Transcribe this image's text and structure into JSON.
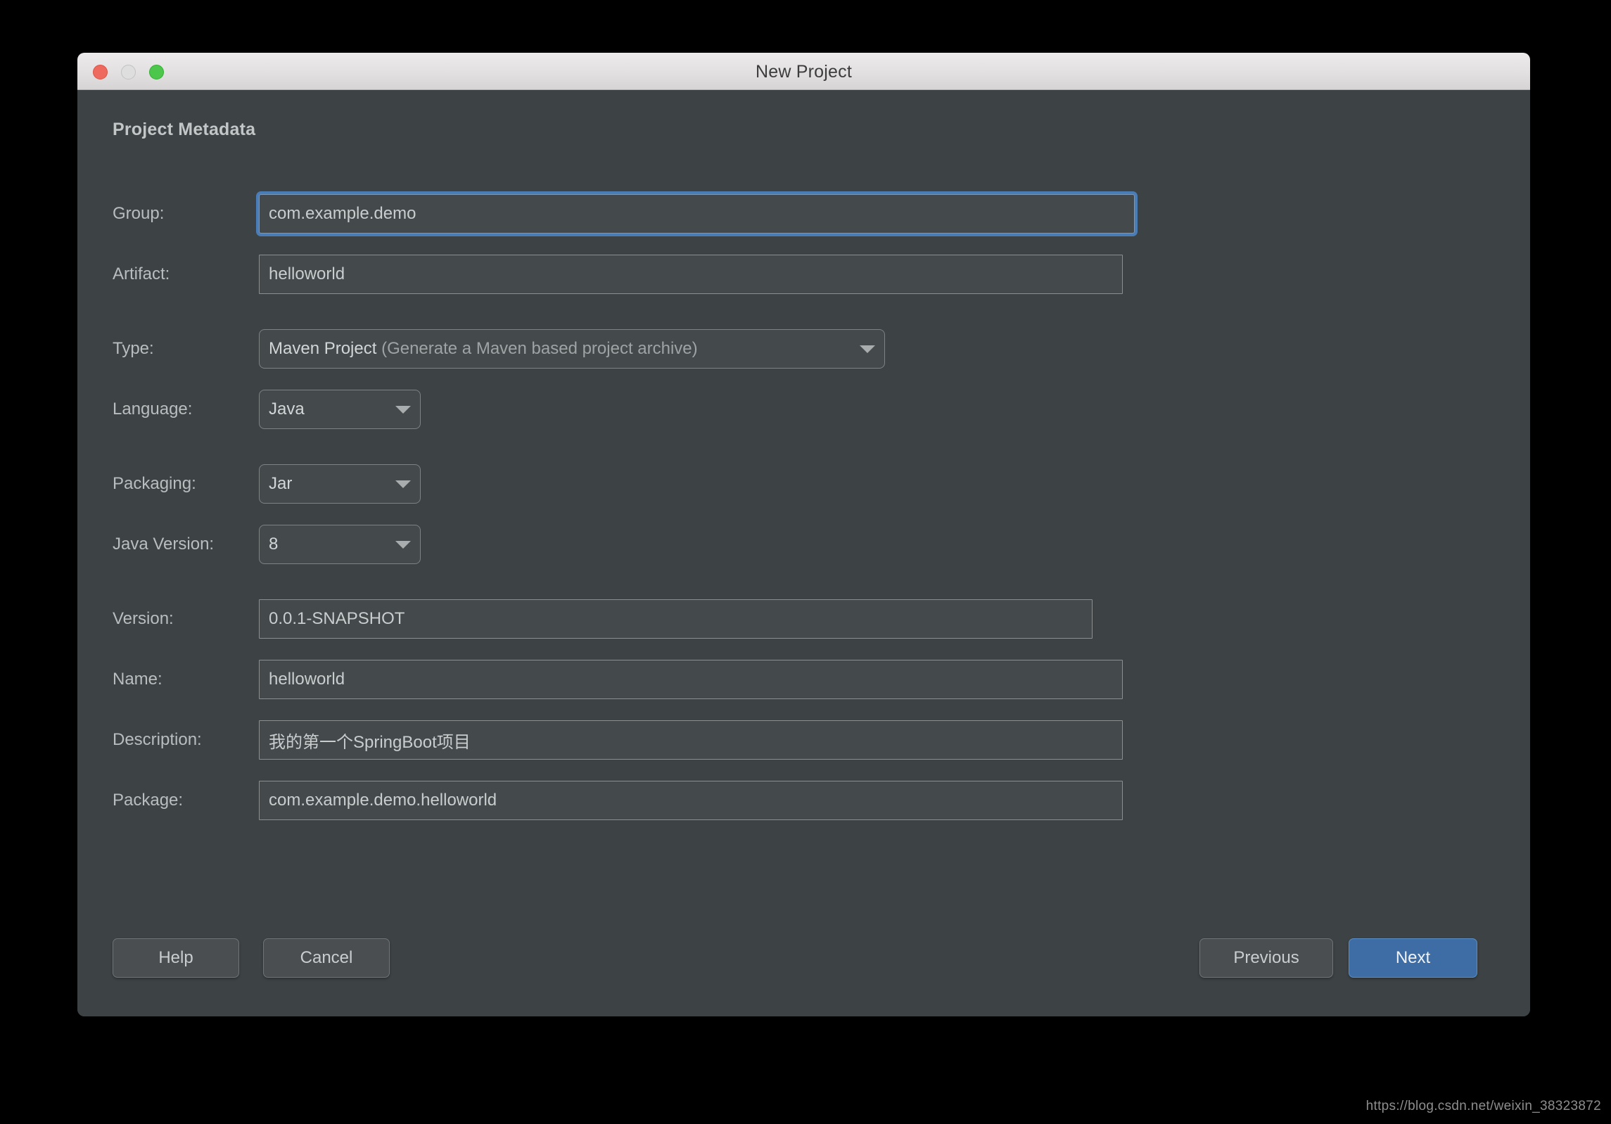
{
  "window": {
    "title": "New Project",
    "traffic_lights": [
      {
        "name": "close",
        "color": "#ee6a5f"
      },
      {
        "name": "minimize",
        "color": "#dedede"
      },
      {
        "name": "maximize",
        "color": "#4cc74c"
      }
    ]
  },
  "section": {
    "title": "Project Metadata"
  },
  "fields": {
    "group": {
      "label": "Group:",
      "value": "com.example.demo",
      "focused": true
    },
    "artifact": {
      "label": "Artifact:",
      "value": "helloworld",
      "focused": false
    },
    "version": {
      "label": "Version:",
      "value": "0.0.1-SNAPSHOT",
      "focused": false
    },
    "name": {
      "label": "Name:",
      "value": "helloworld",
      "focused": false
    },
    "description": {
      "label": "Description:",
      "value": "我的第一个SpringBoot项目",
      "focused": false
    },
    "package": {
      "label": "Package:",
      "value": "com.example.demo.helloworld",
      "focused": false
    }
  },
  "dropdowns": {
    "type": {
      "label": "Type:",
      "value_main": "Maven Project",
      "value_hint": "(Generate a Maven based project archive)",
      "icon": "chevron-down-icon"
    },
    "language": {
      "label": "Language:",
      "value": "Java",
      "icon": "chevron-down-icon"
    },
    "packaging": {
      "label": "Packaging:",
      "value": "Jar",
      "icon": "chevron-down-icon"
    },
    "java_version": {
      "label": "Java Version:",
      "value": "8",
      "icon": "chevron-down-icon"
    }
  },
  "footer": {
    "help": "Help",
    "cancel": "Cancel",
    "previous": "Previous",
    "next": "Next"
  },
  "watermark": {
    "text": "https://blog.csdn.net/weixin_38323872"
  },
  "colors": {
    "dialog_bg": "#3d4245",
    "field_bg": "#44494b",
    "accent": "#3d6da4",
    "focus_ring": "#4a7cb5",
    "text": "#c9cdce"
  }
}
